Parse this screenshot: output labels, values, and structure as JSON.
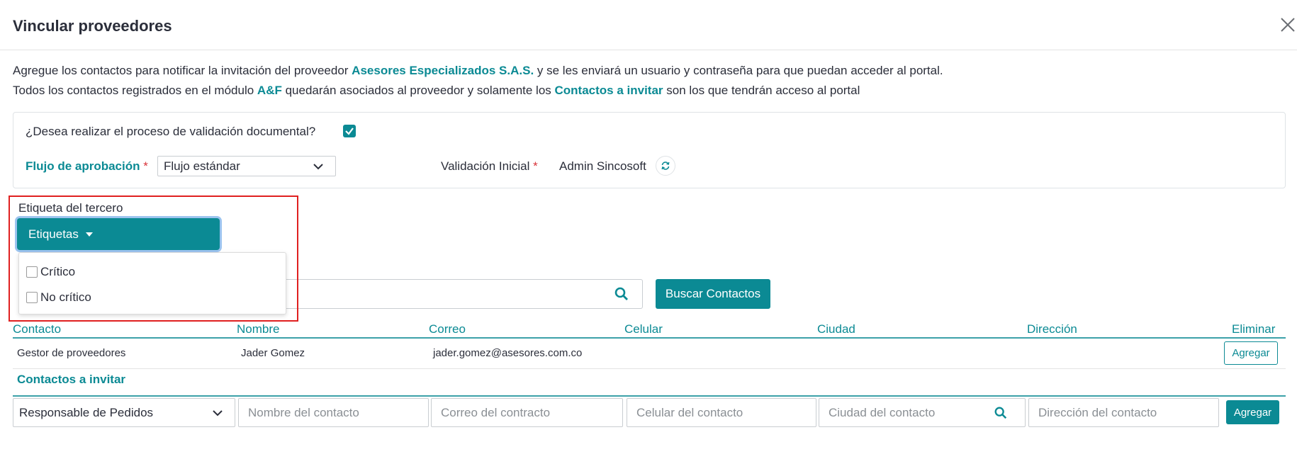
{
  "header": {
    "title": "Vincular proveedores"
  },
  "intro": {
    "line1_a": "Agregue los contactos para notificar la invitación del proveedor ",
    "line1_company": "Asesores Especializados S.A.S.",
    "line1_b": " y se les enviará un usuario y contraseña para que puedan acceder al portal.",
    "line2_a": "Todos los contactos registrados en el módulo ",
    "line2_module": "A&F",
    "line2_b": " quedarán asociados al proveedor y solamente los ",
    "line2_contacts": "Contactos a invitar",
    "line2_c": " son los que tendrán acceso al portal"
  },
  "validation": {
    "question": "¿Desea realizar el proceso de validación documental?",
    "checked": true,
    "flujo_label": "Flujo de aprobación",
    "required_mark": "*",
    "flujo_value": "Flujo estándar",
    "validacion_label": "Validación Inicial",
    "validacion_value": "Admin Sincosoft"
  },
  "tags": {
    "label": "Etiqueta del tercero",
    "button_label": "Etiquetas",
    "options": [
      {
        "label": "Crítico",
        "checked": false
      },
      {
        "label": "No crítico",
        "checked": false
      }
    ]
  },
  "search": {
    "value": "",
    "button_label": "Buscar Contactos"
  },
  "table": {
    "columns": [
      "Contacto",
      "Nombre",
      "Correo",
      "Celular",
      "Ciudad",
      "Dirección",
      "Eliminar"
    ],
    "rows": [
      {
        "contacto": "Gestor de proveedores",
        "nombre": "Jader Gomez",
        "correo": "jader.gomez@asesores.com.co",
        "celular": "",
        "ciudad": "",
        "direccion": "",
        "action": "Agregar"
      }
    ]
  },
  "invite": {
    "title": "Contactos a invitar",
    "role_value": "Responsable de Pedidos",
    "name_placeholder": "Nombre del contacto",
    "email_placeholder": "Correo del contracto",
    "phone_placeholder": "Celular del contacto",
    "city_placeholder": "Ciudad del contacto",
    "address_placeholder": "Dirección del contacto",
    "add_label": "Agregar"
  },
  "colors": {
    "accent": "#0b8a94",
    "highlight": "#e02020",
    "required": "#d9343a"
  }
}
